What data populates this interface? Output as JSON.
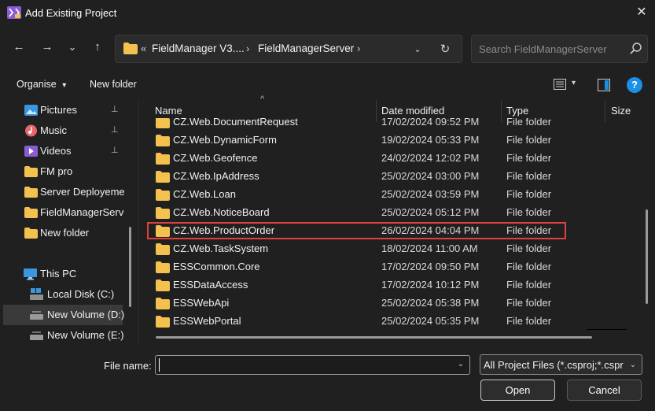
{
  "window": {
    "title": "Add Existing Project",
    "close_glyph": "✕",
    "icon": "visual-studio-icon"
  },
  "nav": {
    "back_glyph": "←",
    "forward_glyph": "→",
    "recent_glyph": "⌄",
    "up_glyph": "↑"
  },
  "address": {
    "overflow": "«",
    "segments": [
      "FieldManager V3....",
      "FieldManagerServer"
    ],
    "separator": "›",
    "dropdown_glyph": "⌄",
    "refresh_glyph": "↻"
  },
  "search": {
    "placeholder": "Search FieldManagerServer",
    "icon": "search-icon"
  },
  "toolbar": {
    "organise": "Organise",
    "organise_caret": "▾",
    "new_folder": "New folder",
    "view_caret": "▾",
    "help": "?"
  },
  "sidebar": {
    "items": [
      {
        "label": "Pictures",
        "icon": "pictures-icon",
        "pinned": true
      },
      {
        "label": "Music",
        "icon": "music-icon",
        "pinned": true
      },
      {
        "label": "Videos",
        "icon": "videos-icon",
        "pinned": true
      },
      {
        "label": "FM pro",
        "icon": "folder-icon",
        "pinned": false
      },
      {
        "label": "Server Deployement",
        "icon": "folder-icon",
        "pinned": false
      },
      {
        "label": "FieldManagerServer",
        "icon": "folder-icon",
        "pinned": false
      },
      {
        "label": "New folder",
        "icon": "folder-icon",
        "pinned": false
      }
    ],
    "this_pc": "This PC",
    "drives": [
      {
        "label": "Local Disk (C:)",
        "selected": false
      },
      {
        "label": "New Volume (D:)",
        "selected": true
      },
      {
        "label": "New Volume (E:)",
        "selected": false
      }
    ],
    "pin_glyph": "📌"
  },
  "columns": {
    "name": "Name",
    "date": "Date modified",
    "type": "Type",
    "size": "Size",
    "sort_glyph": "^"
  },
  "files": [
    {
      "name": "CZ.Web.DocumentRequest",
      "date": "17/02/2024 09:52 PM",
      "type": "File folder"
    },
    {
      "name": "CZ.Web.DynamicForm",
      "date": "19/02/2024 05:33 PM",
      "type": "File folder"
    },
    {
      "name": "CZ.Web.Geofence",
      "date": "24/02/2024 12:02 PM",
      "type": "File folder"
    },
    {
      "name": "CZ.Web.IpAddress",
      "date": "25/02/2024 03:00 PM",
      "type": "File folder"
    },
    {
      "name": "CZ.Web.Loan",
      "date": "25/02/2024 03:59 PM",
      "type": "File folder"
    },
    {
      "name": "CZ.Web.NoticeBoard",
      "date": "25/02/2024 05:12 PM",
      "type": "File folder"
    },
    {
      "name": "CZ.Web.ProductOrder",
      "date": "26/02/2024 04:04 PM",
      "type": "File folder"
    },
    {
      "name": "CZ.Web.TaskSystem",
      "date": "18/02/2024 11:00 AM",
      "type": "File folder"
    },
    {
      "name": "ESSCommon.Core",
      "date": "17/02/2024 09:50 PM",
      "type": "File folder"
    },
    {
      "name": "ESSDataAccess",
      "date": "17/02/2024 10:12 PM",
      "type": "File folder"
    },
    {
      "name": "ESSWebApi",
      "date": "25/02/2024 05:38 PM",
      "type": "File folder"
    },
    {
      "name": "ESSWebPortal",
      "date": "25/02/2024 05:35 PM",
      "type": "File folder"
    }
  ],
  "footer": {
    "file_name_label": "File name:",
    "file_name_value": "",
    "filter_value": "All Project Files (*.csproj;*.csproj;*.vbproj)",
    "open": "Open",
    "cancel": "Cancel",
    "dropdown_glyph": "⌄"
  },
  "colors": {
    "background": "#202020",
    "highlight_border": "#e04040",
    "folder": "#f2c14e",
    "help_blue": "#1a8fe3"
  }
}
